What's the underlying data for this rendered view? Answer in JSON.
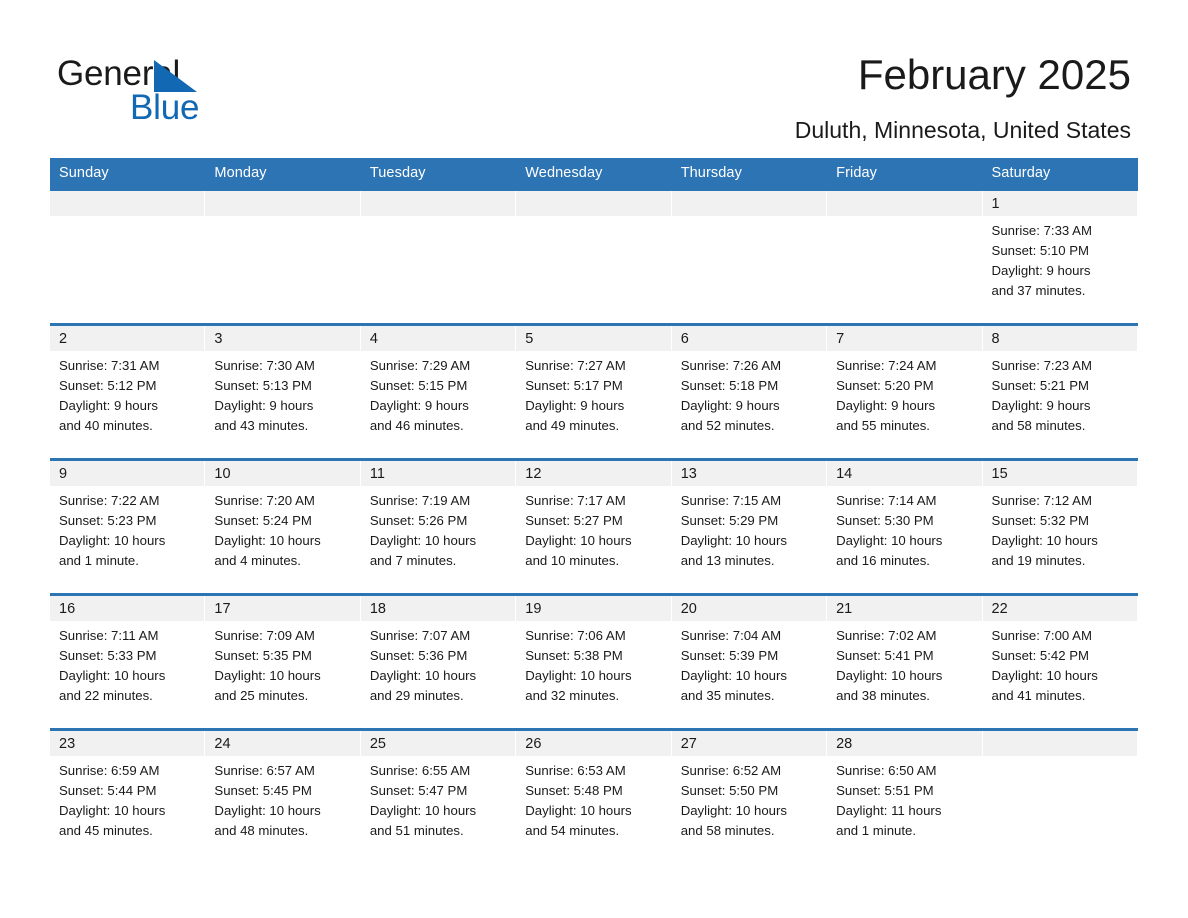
{
  "brand": {
    "name_part1": "General",
    "name_part2": "Blue",
    "accent_color": "#1268b3"
  },
  "header": {
    "title": "February 2025",
    "subtitle": "Duluth, Minnesota, United States",
    "header_bg_color": "#2d74b4"
  },
  "calendar": {
    "weekday_headers": [
      "Sunday",
      "Monday",
      "Tuesday",
      "Wednesday",
      "Thursday",
      "Friday",
      "Saturday"
    ],
    "weeks": [
      [
        {
          "day": "",
          "text": ""
        },
        {
          "day": "",
          "text": ""
        },
        {
          "day": "",
          "text": ""
        },
        {
          "day": "",
          "text": ""
        },
        {
          "day": "",
          "text": ""
        },
        {
          "day": "",
          "text": ""
        },
        {
          "day": "1",
          "text": "Sunrise: 7:33 AM\nSunset: 5:10 PM\nDaylight: 9 hours\nand 37 minutes."
        }
      ],
      [
        {
          "day": "2",
          "text": "Sunrise: 7:31 AM\nSunset: 5:12 PM\nDaylight: 9 hours\nand 40 minutes."
        },
        {
          "day": "3",
          "text": "Sunrise: 7:30 AM\nSunset: 5:13 PM\nDaylight: 9 hours\nand 43 minutes."
        },
        {
          "day": "4",
          "text": "Sunrise: 7:29 AM\nSunset: 5:15 PM\nDaylight: 9 hours\nand 46 minutes."
        },
        {
          "day": "5",
          "text": "Sunrise: 7:27 AM\nSunset: 5:17 PM\nDaylight: 9 hours\nand 49 minutes."
        },
        {
          "day": "6",
          "text": "Sunrise: 7:26 AM\nSunset: 5:18 PM\nDaylight: 9 hours\nand 52 minutes."
        },
        {
          "day": "7",
          "text": "Sunrise: 7:24 AM\nSunset: 5:20 PM\nDaylight: 9 hours\nand 55 minutes."
        },
        {
          "day": "8",
          "text": "Sunrise: 7:23 AM\nSunset: 5:21 PM\nDaylight: 9 hours\nand 58 minutes."
        }
      ],
      [
        {
          "day": "9",
          "text": "Sunrise: 7:22 AM\nSunset: 5:23 PM\nDaylight: 10 hours\nand 1 minute."
        },
        {
          "day": "10",
          "text": "Sunrise: 7:20 AM\nSunset: 5:24 PM\nDaylight: 10 hours\nand 4 minutes."
        },
        {
          "day": "11",
          "text": "Sunrise: 7:19 AM\nSunset: 5:26 PM\nDaylight: 10 hours\nand 7 minutes."
        },
        {
          "day": "12",
          "text": "Sunrise: 7:17 AM\nSunset: 5:27 PM\nDaylight: 10 hours\nand 10 minutes."
        },
        {
          "day": "13",
          "text": "Sunrise: 7:15 AM\nSunset: 5:29 PM\nDaylight: 10 hours\nand 13 minutes."
        },
        {
          "day": "14",
          "text": "Sunrise: 7:14 AM\nSunset: 5:30 PM\nDaylight: 10 hours\nand 16 minutes."
        },
        {
          "day": "15",
          "text": "Sunrise: 7:12 AM\nSunset: 5:32 PM\nDaylight: 10 hours\nand 19 minutes."
        }
      ],
      [
        {
          "day": "16",
          "text": "Sunrise: 7:11 AM\nSunset: 5:33 PM\nDaylight: 10 hours\nand 22 minutes."
        },
        {
          "day": "17",
          "text": "Sunrise: 7:09 AM\nSunset: 5:35 PM\nDaylight: 10 hours\nand 25 minutes."
        },
        {
          "day": "18",
          "text": "Sunrise: 7:07 AM\nSunset: 5:36 PM\nDaylight: 10 hours\nand 29 minutes."
        },
        {
          "day": "19",
          "text": "Sunrise: 7:06 AM\nSunset: 5:38 PM\nDaylight: 10 hours\nand 32 minutes."
        },
        {
          "day": "20",
          "text": "Sunrise: 7:04 AM\nSunset: 5:39 PM\nDaylight: 10 hours\nand 35 minutes."
        },
        {
          "day": "21",
          "text": "Sunrise: 7:02 AM\nSunset: 5:41 PM\nDaylight: 10 hours\nand 38 minutes."
        },
        {
          "day": "22",
          "text": "Sunrise: 7:00 AM\nSunset: 5:42 PM\nDaylight: 10 hours\nand 41 minutes."
        }
      ],
      [
        {
          "day": "23",
          "text": "Sunrise: 6:59 AM\nSunset: 5:44 PM\nDaylight: 10 hours\nand 45 minutes."
        },
        {
          "day": "24",
          "text": "Sunrise: 6:57 AM\nSunset: 5:45 PM\nDaylight: 10 hours\nand 48 minutes."
        },
        {
          "day": "25",
          "text": "Sunrise: 6:55 AM\nSunset: 5:47 PM\nDaylight: 10 hours\nand 51 minutes."
        },
        {
          "day": "26",
          "text": "Sunrise: 6:53 AM\nSunset: 5:48 PM\nDaylight: 10 hours\nand 54 minutes."
        },
        {
          "day": "27",
          "text": "Sunrise: 6:52 AM\nSunset: 5:50 PM\nDaylight: 10 hours\nand 58 minutes."
        },
        {
          "day": "28",
          "text": "Sunrise: 6:50 AM\nSunset: 5:51 PM\nDaylight: 11 hours\nand 1 minute."
        },
        {
          "day": "",
          "text": ""
        }
      ]
    ]
  }
}
